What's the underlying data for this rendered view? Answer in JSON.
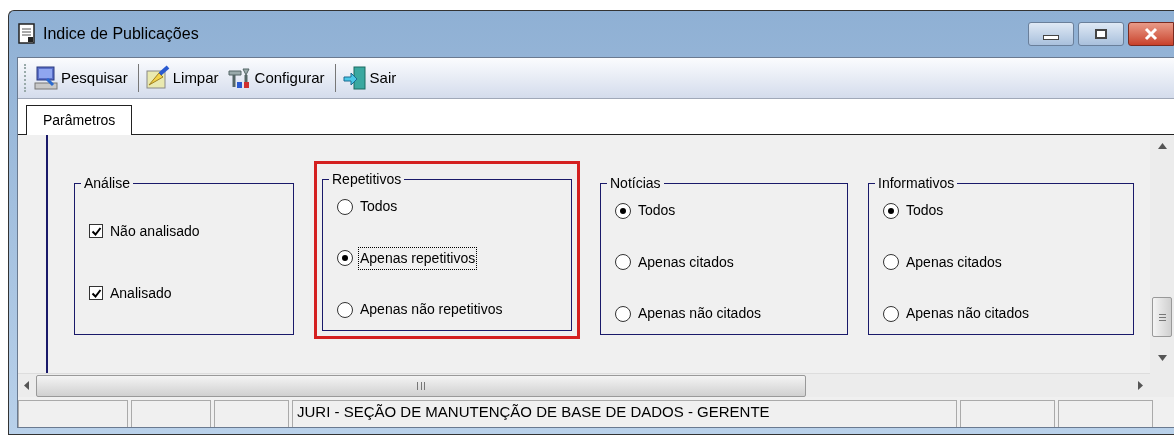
{
  "window": {
    "title": "Indice de Publicações"
  },
  "toolbar": [
    {
      "label": "Pesquisar"
    },
    {
      "label": "Limpar"
    },
    {
      "label": "Configurar"
    },
    {
      "label": "Sair"
    }
  ],
  "tabs": [
    {
      "label": "Parâmetros",
      "selected": true
    }
  ],
  "groups": [
    {
      "title": "Análise",
      "kind": "checkbox",
      "highlighted": false,
      "options": [
        {
          "label": "Não analisado",
          "checked": true
        },
        {
          "label": "Analisado",
          "checked": true
        }
      ]
    },
    {
      "title": "Repetitivos",
      "kind": "radio",
      "highlighted": true,
      "options": [
        {
          "label": "Todos",
          "selected": false,
          "focused": false
        },
        {
          "label": "Apenas repetitivos",
          "selected": true,
          "focused": true
        },
        {
          "label": "Apenas não repetitivos",
          "selected": false,
          "focused": false
        }
      ]
    },
    {
      "title": "Notícias",
      "kind": "radio",
      "highlighted": false,
      "options": [
        {
          "label": "Todos",
          "selected": true,
          "focused": false
        },
        {
          "label": "Apenas citados",
          "selected": false,
          "focused": false
        },
        {
          "label": "Apenas não citados",
          "selected": false,
          "focused": false
        }
      ]
    },
    {
      "title": "Informativos",
      "kind": "radio",
      "highlighted": false,
      "options": [
        {
          "label": "Todos",
          "selected": true,
          "focused": false
        },
        {
          "label": "Apenas citados",
          "selected": false,
          "focused": false
        },
        {
          "label": "Apenas não citados",
          "selected": false,
          "focused": false
        }
      ]
    }
  ],
  "status_bar": {
    "message": "JURI - SEÇÃO DE MANUTENÇÃO DE BASE DE DADOS - GERENTE"
  }
}
